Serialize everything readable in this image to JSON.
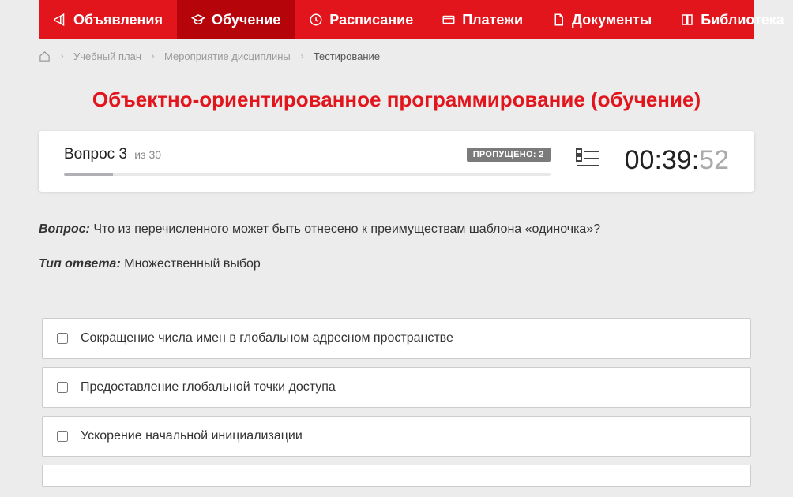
{
  "nav": {
    "items": [
      {
        "label": "Объявления",
        "icon": "megaphone-icon",
        "active": false,
        "caret": false
      },
      {
        "label": "Обучение",
        "icon": "education-icon",
        "active": true,
        "caret": false
      },
      {
        "label": "Расписание",
        "icon": "clock-icon",
        "active": false,
        "caret": false
      },
      {
        "label": "Платежи",
        "icon": "payment-icon",
        "active": false,
        "caret": false
      },
      {
        "label": "Документы",
        "icon": "document-icon",
        "active": false,
        "caret": false
      },
      {
        "label": "Библиотека",
        "icon": "book-icon",
        "active": false,
        "caret": true
      }
    ]
  },
  "breadcrumb": {
    "items": [
      {
        "label": "Учебный план",
        "current": false
      },
      {
        "label": "Мероприятие дисциплины",
        "current": false
      },
      {
        "label": "Тестирование",
        "current": true
      }
    ]
  },
  "title": "Объектно-ориентированное программирование (обучение)",
  "status": {
    "question_label": "Вопрос 3",
    "question_total_prefix": "из",
    "question_total": "30",
    "skipped_label": "ПРОПУЩЕНО: 2",
    "progress_percent": 10,
    "timer": {
      "mm": "00",
      "ss": "39",
      "cs": "52"
    }
  },
  "question": {
    "prompt_label": "Вопрос:",
    "prompt_text": "Что из перечисленного может быть отнесено к преимуществам шаблона «одиночка»?",
    "answer_type_label": "Тип ответа:",
    "answer_type_text": "Множественный выбор"
  },
  "options": [
    {
      "text": "Сокращение числа имен в глобальном адресном пространстве"
    },
    {
      "text": "Предоставление глобальной точки доступа"
    },
    {
      "text": "Ускорение начальной инициализации"
    }
  ]
}
